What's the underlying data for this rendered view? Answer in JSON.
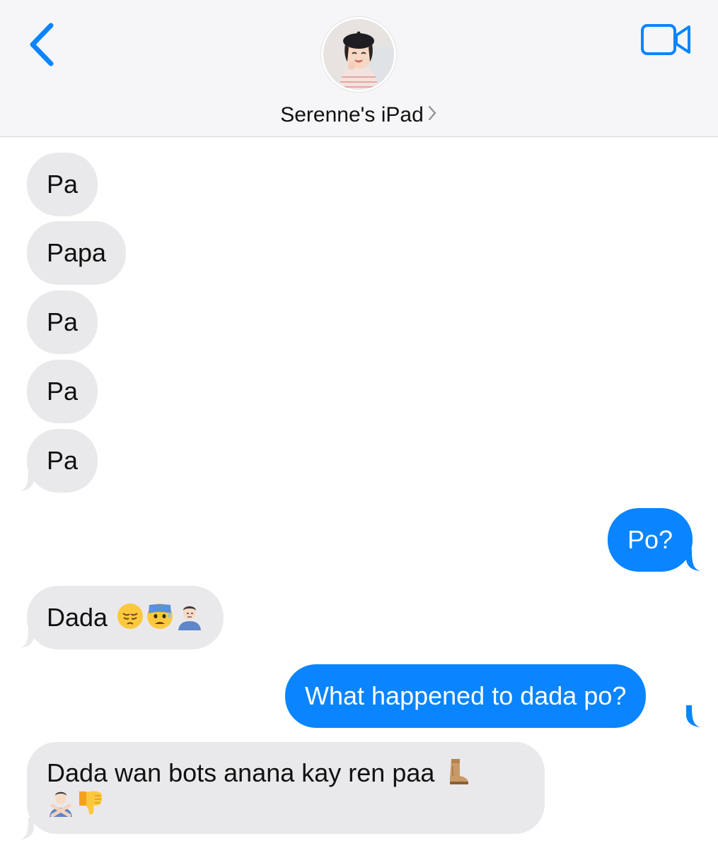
{
  "header": {
    "contact_name": "Serenne's iPad",
    "back_icon": "chevron-left-icon",
    "facetime_icon": "video-camera-icon",
    "avatar": "child-photo-avatar"
  },
  "colors": {
    "accent": "#0a84ff",
    "incoming_bubble": "#e9e9ec",
    "outgoing_bubble": "#0a84ff",
    "header_bg": "#f6f6f8"
  },
  "messages": [
    {
      "direction": "incoming",
      "text": "Pa"
    },
    {
      "direction": "incoming",
      "text": "Papa"
    },
    {
      "direction": "incoming",
      "text": "Pa"
    },
    {
      "direction": "incoming",
      "text": "Pa"
    },
    {
      "direction": "incoming",
      "text": "Pa"
    },
    {
      "direction": "outgoing",
      "text": "Po?"
    },
    {
      "direction": "incoming",
      "text": "Dada",
      "emoji": [
        "pensive-face-emoji",
        "anxious-face-with-sweat-emoji",
        "man-facepalming-emoji"
      ]
    },
    {
      "direction": "outgoing",
      "text": "What happened to dada po?"
    },
    {
      "direction": "incoming",
      "text": "Dada wan bots anana kay ren paa",
      "emoji": [
        "boot-emoji",
        "man-gesturing-no-emoji",
        "thumbs-down-emoji"
      ]
    }
  ]
}
